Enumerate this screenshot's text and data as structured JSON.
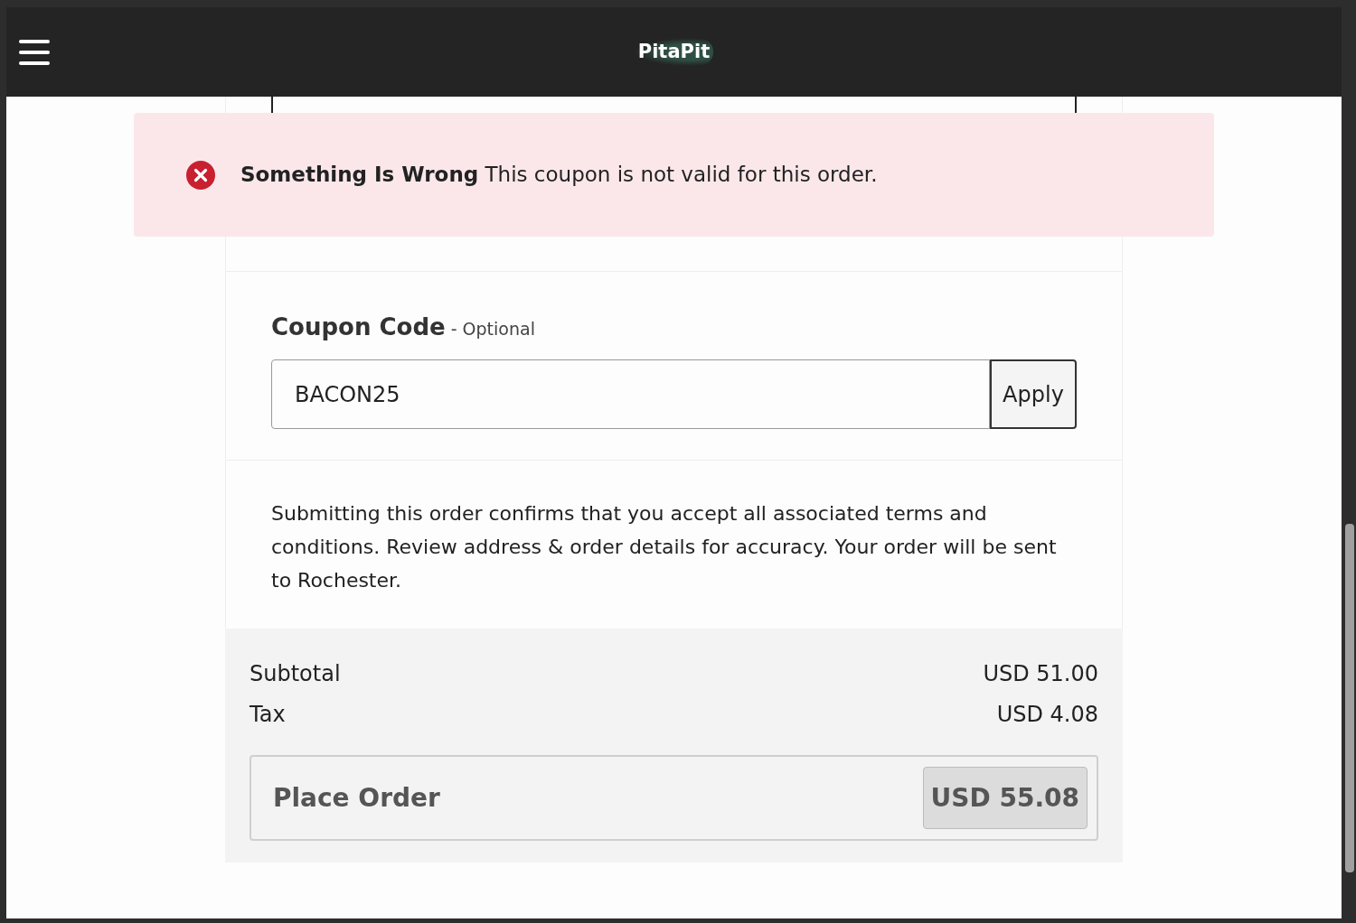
{
  "header": {
    "logo": "PitaPit"
  },
  "alert": {
    "title": "Something Is Wrong",
    "message": "This coupon is not valid for this order."
  },
  "coupon": {
    "label": "Coupon Code",
    "optional": "- Optional",
    "value": "BACON25",
    "button": "Apply"
  },
  "terms": "Submitting this order confirms that you accept all associated terms and conditions. Review address & order details for accuracy. Your order will be sent to Rochester.",
  "totals": [
    {
      "label": "Subtotal",
      "value": "USD 51.00"
    },
    {
      "label": "Tax",
      "value": "USD 4.08"
    }
  ],
  "place_order": {
    "label": "Place Order",
    "total": "USD 55.08",
    "disabled": true
  }
}
